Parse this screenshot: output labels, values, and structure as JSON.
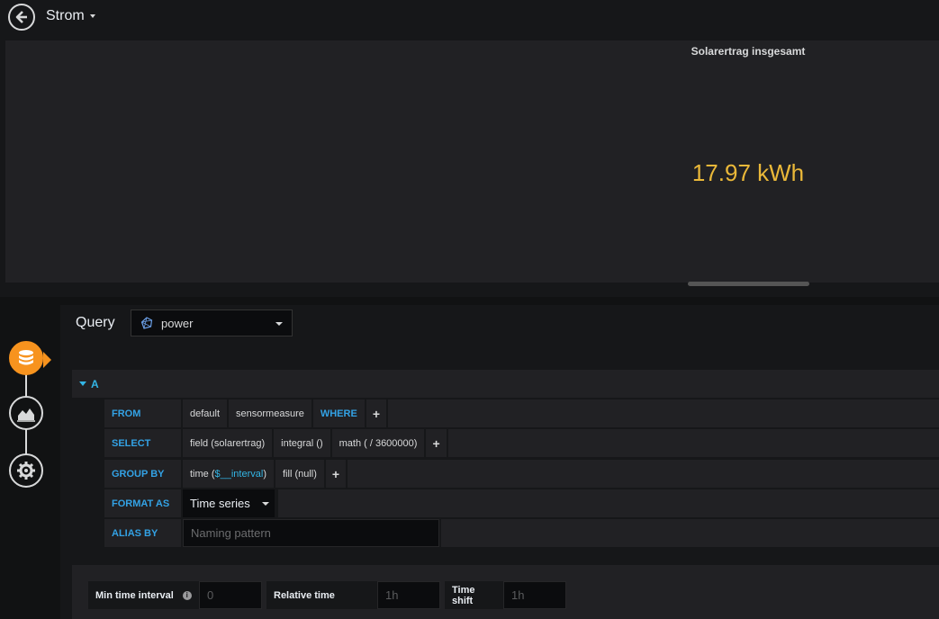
{
  "header": {
    "title": "Strom"
  },
  "panel": {
    "title": "Solarertrag insgesamt",
    "value": "17.97 kWh",
    "value_color": "#eab839"
  },
  "editor": {
    "query_label": "Query",
    "datasource": "power",
    "query": {
      "letter": "A",
      "from": {
        "label": "FROM",
        "policy": "default",
        "measurement": "sensormeasure",
        "where": "WHERE",
        "add": "+"
      },
      "select": {
        "label": "SELECT",
        "field": "field (solarertrag)",
        "fn1": "integral ()",
        "fn2": "math ( / 3600000)",
        "add": "+"
      },
      "group_by": {
        "label": "GROUP BY",
        "time_prefix": "time (",
        "time_var": "$__interval",
        "time_suffix": ")",
        "fill": "fill (null)",
        "add": "+"
      },
      "format_as": {
        "label": "FORMAT AS",
        "value": "Time series"
      },
      "alias_by": {
        "label": "ALIAS BY",
        "placeholder": "Naming pattern"
      }
    },
    "options": {
      "min_interval": {
        "label": "Min time interval",
        "placeholder": "0"
      },
      "relative_time": {
        "label": "Relative time",
        "placeholder": "1h"
      },
      "time_shift": {
        "label": "Time shift",
        "placeholder": "1h"
      }
    }
  },
  "icons": {
    "back": "arrow-left-icon",
    "datasource": "influxdb-icon",
    "queries": "database-icon",
    "visualization": "area-chart-icon",
    "general": "gear-icon",
    "info": "info-icon"
  },
  "colors": {
    "accent": "#33b5e5",
    "active_tab": "#f7931e"
  }
}
